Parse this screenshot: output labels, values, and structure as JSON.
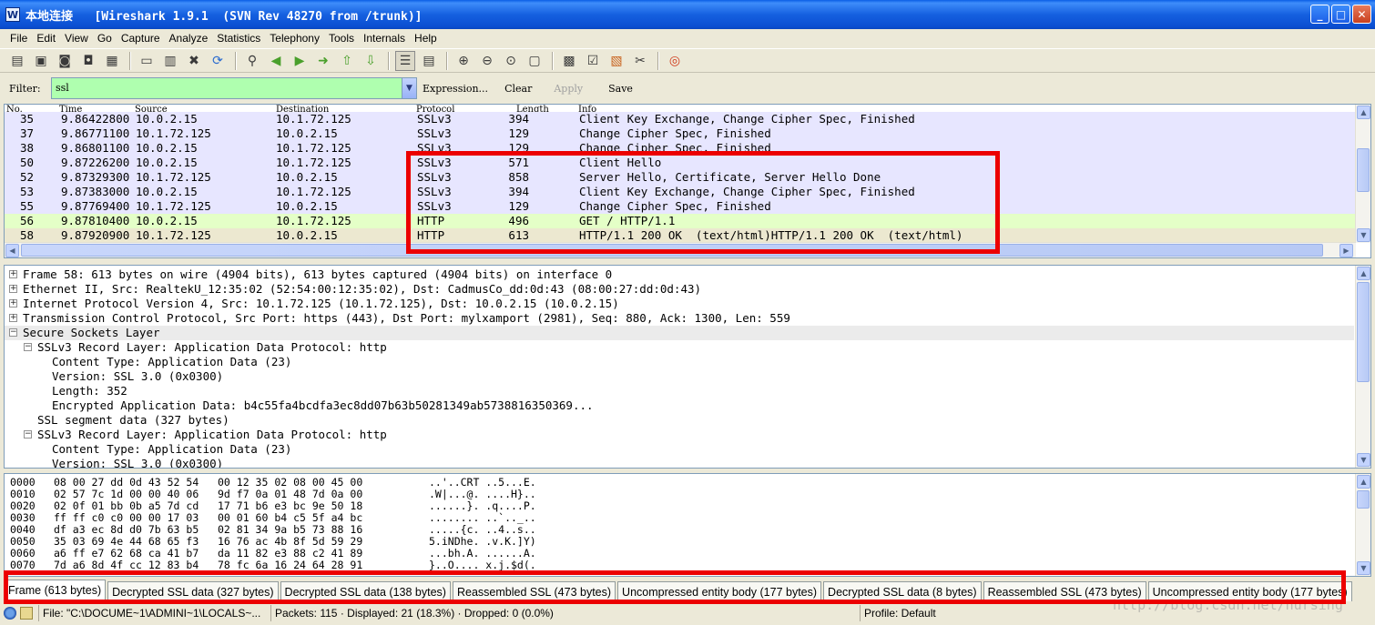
{
  "window": {
    "title": "本地连接   [Wireshark 1.9.1  (SVN Rev 48270 from /trunk)]",
    "minimize": "_",
    "maximize": "□",
    "close": "✕"
  },
  "menu": [
    "File",
    "Edit",
    "View",
    "Go",
    "Capture",
    "Analyze",
    "Statistics",
    "Telephony",
    "Tools",
    "Internals",
    "Help"
  ],
  "filter": {
    "label": "Filter:",
    "value": "ssl",
    "expression": "Expression...",
    "clear": "Clear",
    "apply": "Apply",
    "save": "Save"
  },
  "packet_list": {
    "columns": [
      "No.",
      "Time",
      "Source",
      "Destination",
      "Protocol",
      "Length",
      "Info"
    ],
    "rows": [
      {
        "no": "35",
        "time": "9.86422800",
        "src": "10.0.2.15",
        "dst": "10.1.72.125",
        "proto": "SSLv3",
        "len": "394",
        "info": "Client Key Exchange, Change Cipher Spec, Finished"
      },
      {
        "no": "37",
        "time": "9.86771100",
        "src": "10.1.72.125",
        "dst": "10.0.2.15",
        "proto": "SSLv3",
        "len": "129",
        "info": "Change Cipher Spec, Finished"
      },
      {
        "no": "38",
        "time": "9.86801100",
        "src": "10.0.2.15",
        "dst": "10.1.72.125",
        "proto": "SSLv3",
        "len": "129",
        "info": "Change Cipher Spec, Finished"
      },
      {
        "no": "50",
        "time": "9.87226200",
        "src": "10.0.2.15",
        "dst": "10.1.72.125",
        "proto": "SSLv3",
        "len": "571",
        "info": "Client Hello"
      },
      {
        "no": "52",
        "time": "9.87329300",
        "src": "10.1.72.125",
        "dst": "10.0.2.15",
        "proto": "SSLv3",
        "len": "858",
        "info": "Server Hello, Certificate, Server Hello Done"
      },
      {
        "no": "53",
        "time": "9.87383000",
        "src": "10.0.2.15",
        "dst": "10.1.72.125",
        "proto": "SSLv3",
        "len": "394",
        "info": "Client Key Exchange, Change Cipher Spec, Finished"
      },
      {
        "no": "55",
        "time": "9.87769400",
        "src": "10.1.72.125",
        "dst": "10.0.2.15",
        "proto": "SSLv3",
        "len": "129",
        "info": "Change Cipher Spec, Finished"
      },
      {
        "no": "56",
        "time": "9.87810400",
        "src": "10.0.2.15",
        "dst": "10.1.72.125",
        "proto": "HTTP",
        "len": "496",
        "info": "GET / HTTP/1.1"
      },
      {
        "no": "58",
        "time": "9.87920900",
        "src": "10.1.72.125",
        "dst": "10.0.2.15",
        "proto": "HTTP",
        "len": "613",
        "info": "HTTP/1.1 200 OK  (text/html)HTTP/1.1 200 OK  (text/html)"
      }
    ]
  },
  "details": [
    {
      "exp": "+",
      "text": "Frame 58: 613 bytes on wire (4904 bits), 613 bytes captured (4904 bits) on interface 0"
    },
    {
      "exp": "+",
      "text": "Ethernet II, Src: RealtekU_12:35:02 (52:54:00:12:35:02), Dst: CadmusCo_dd:0d:43 (08:00:27:dd:0d:43)"
    },
    {
      "exp": "+",
      "text": "Internet Protocol Version 4, Src: 10.1.72.125 (10.1.72.125), Dst: 10.0.2.15 (10.0.2.15)"
    },
    {
      "exp": "+",
      "text": "Transmission Control Protocol, Src Port: https (443), Dst Port: mylxamport (2981), Seq: 880, Ack: 1300, Len: 559"
    },
    {
      "exp": "−",
      "text": "Secure Sockets Layer"
    },
    {
      "exp": "−",
      "text": "SSLv3 Record Layer: Application Data Protocol: http"
    },
    {
      "exp": "",
      "text": "Content Type: Application Data (23)"
    },
    {
      "exp": "",
      "text": "Version: SSL 3.0 (0x0300)"
    },
    {
      "exp": "",
      "text": "Length: 352"
    },
    {
      "exp": "",
      "text": "Encrypted Application Data: b4c55fa4bcdfa3ec8dd07b63b50281349ab5738816350369..."
    },
    {
      "exp": "",
      "text": "SSL segment data (327 bytes)"
    },
    {
      "exp": "−",
      "text": "SSLv3 Record Layer: Application Data Protocol: http"
    },
    {
      "exp": "",
      "text": "Content Type: Application Data (23)"
    },
    {
      "exp": "",
      "text": "Version: SSL 3.0 (0x0300)"
    }
  ],
  "hex": [
    {
      "off": "0000",
      "bytes": "08 00 27 dd 0d 43 52 54   00 12 35 02 08 00 45 00",
      "ascii": "..'..CRT ..5...E."
    },
    {
      "off": "0010",
      "bytes": "02 57 7c 1d 00 00 40 06   9d f7 0a 01 48 7d 0a 00",
      "ascii": ".W|...@. ....H}.."
    },
    {
      "off": "0020",
      "bytes": "02 0f 01 bb 0b a5 7d cd   17 71 b6 e3 bc 9e 50 18",
      "ascii": "......}. .q....P."
    },
    {
      "off": "0030",
      "bytes": "ff ff c0 c0 00 00 17 03   00 01 60 b4 c5 5f a4 bc",
      "ascii": "........ ..`.._.."
    },
    {
      "off": "0040",
      "bytes": "df a3 ec 8d d0 7b 63 b5   02 81 34 9a b5 73 88 16",
      "ascii": ".....{c. ..4..s.."
    },
    {
      "off": "0050",
      "bytes": "35 03 69 4e 44 68 65 f3   16 76 ac 4b 8f 5d 59 29",
      "ascii": "5.iNDhe. .v.K.]Y)"
    },
    {
      "off": "0060",
      "bytes": "a6 ff e7 62 68 ca 41 b7   da 11 82 e3 88 c2 41 89",
      "ascii": "...bh.A. ......A."
    },
    {
      "off": "0070",
      "bytes": "7d a6 8d 4f cc 12 83 b4   78 fc 6a 16 24 64 28 91",
      "ascii": "}..O.... x.j.$d(."
    }
  ],
  "tabs": [
    "Frame (613 bytes)",
    "Decrypted SSL data (327 bytes)",
    "Decrypted SSL data (138 bytes)",
    "Reassembled SSL (473 bytes)",
    "Uncompressed entity body (177 bytes)",
    "Decrypted SSL data (8 bytes)",
    "Reassembled SSL (473 bytes)",
    "Uncompressed entity body (177 bytes)"
  ],
  "status": {
    "file": "File: \"C:\\DOCUME~1\\ADMINI~1\\LOCALS~...",
    "packets": "Packets: 115 · Displayed: 21 (18.3%)  · Dropped: 0 (0.0%)",
    "profile": "Profile: Default"
  },
  "watermark": "http://blog.csdn.net/hursing",
  "colors": {
    "ssl_row": "#e7e6ff",
    "http_row": "#e4ffc7",
    "filter_ok": "#afffaf",
    "annotation": "#ec0000"
  }
}
